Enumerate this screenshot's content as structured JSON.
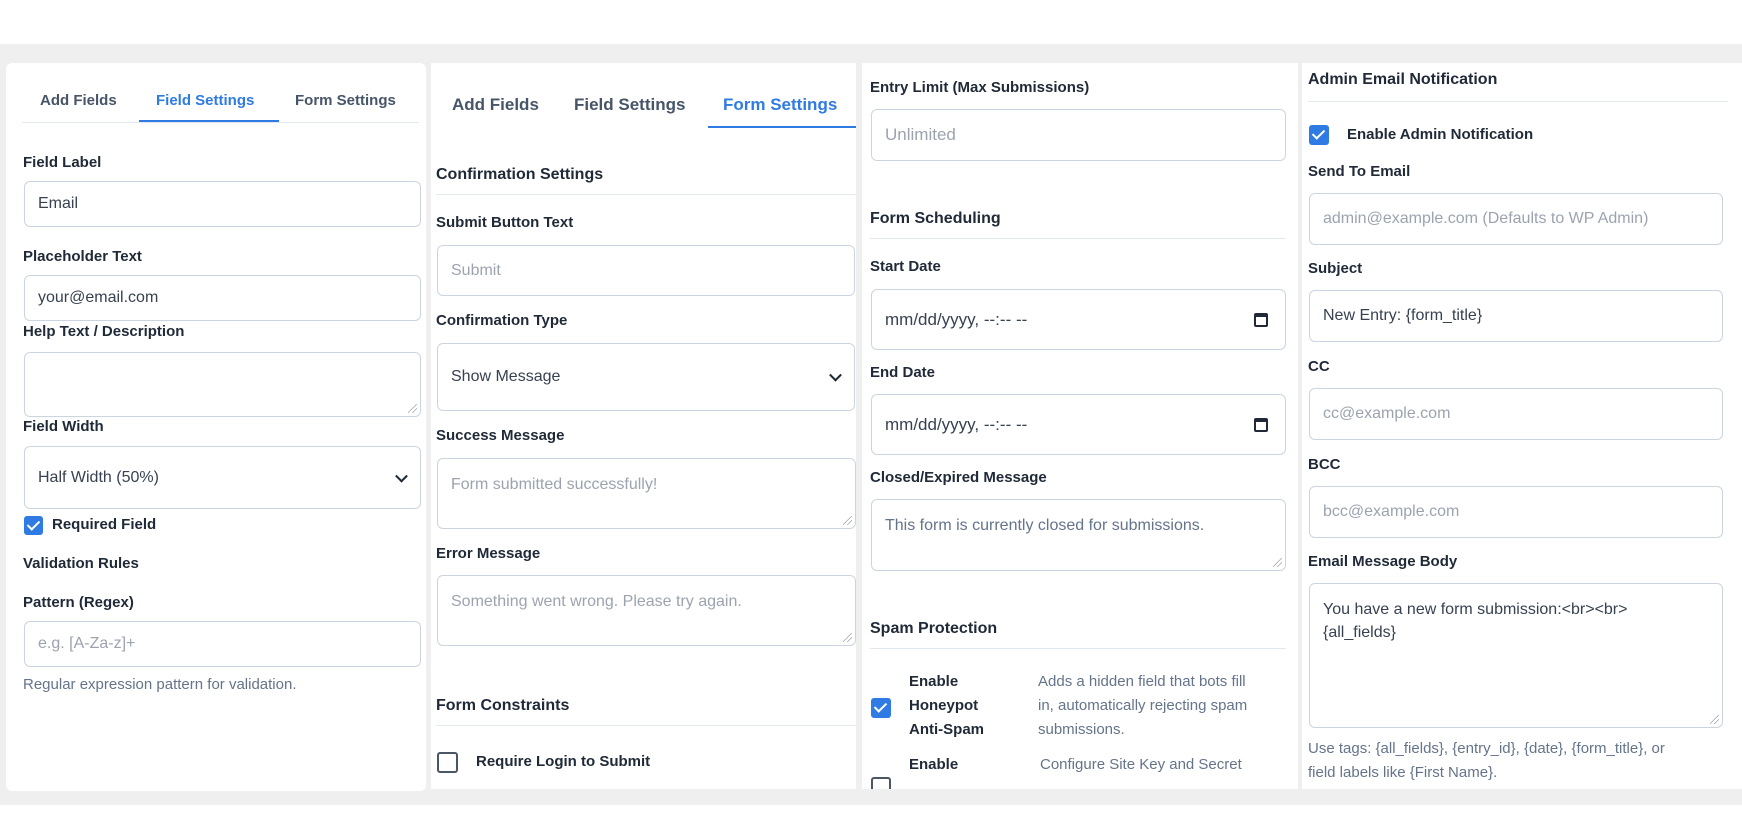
{
  "panel1": {
    "tabs": [
      "Add Fields",
      "Field Settings",
      "Form Settings"
    ],
    "field_label": "Field Label",
    "field_label_value": "Email",
    "placeholder_label": "Placeholder Text",
    "placeholder_value": "your@email.com",
    "help_label": "Help Text / Description",
    "width_label": "Field Width",
    "width_value": "Half Width (50%)",
    "required_label": "Required Field",
    "validation_title": "Validation Rules",
    "pattern_label": "Pattern (Regex)",
    "pattern_placeholder": "e.g. [A-Za-z]+",
    "pattern_help": "Regular expression pattern for validation."
  },
  "panel2": {
    "tabs": [
      "Add Fields",
      "Field Settings",
      "Form Settings"
    ],
    "confirmation_title": "Confirmation Settings",
    "submit_label": "Submit Button Text",
    "submit_placeholder": "Submit",
    "confirm_type_label": "Confirmation Type",
    "confirm_type_value": "Show Message",
    "success_label": "Success Message",
    "success_placeholder": "Form submitted successfully!",
    "error_label": "Error Message",
    "error_placeholder": "Something went wrong. Please try again.",
    "constraints_title": "Form Constraints",
    "require_login_label": "Require Login to Submit"
  },
  "panel3": {
    "entry_limit_label": "Entry Limit (Max Submissions)",
    "entry_limit_placeholder": "Unlimited",
    "scheduling_title": "Form Scheduling",
    "start_label": "Start Date",
    "start_value": "mm/dd/yyyy, --:-- --",
    "end_label": "End Date",
    "end_value": "mm/dd/yyyy, --:-- --",
    "closed_label": "Closed/Expired Message",
    "closed_placeholder": "This form is currently closed for submissions.",
    "spam_title": "Spam Protection",
    "honeypot_label": [
      "Enable",
      "Honeypot",
      "Anti-Spam"
    ],
    "honeypot_desc": [
      "Adds a hidden field that bots fill",
      "in, automatically rejecting spam",
      "submissions."
    ],
    "recaptcha_label": "Enable",
    "recaptcha_desc": "Configure Site Key and Secret"
  },
  "panel4": {
    "title": "Admin Email Notification",
    "enable_label": "Enable Admin Notification",
    "send_to_label": "Send To Email",
    "send_to_placeholder": "admin@example.com (Defaults to WP Admin)",
    "subject_label": "Subject",
    "subject_value": "New Entry: {form_title}",
    "cc_label": "CC",
    "cc_placeholder": "cc@example.com",
    "bcc_label": "BCC",
    "bcc_placeholder": "bcc@example.com",
    "body_label": "Email Message Body",
    "body_lines": [
      "You have a new form submission:<br><br>",
      "{all_fields}"
    ],
    "tags_help": [
      "Use tags: {all_fields}, {entry_id}, {date}, {form_title}, or",
      "field labels like {First Name}."
    ]
  },
  "colors": {
    "accent": "#2f7be3",
    "background": "#efefef"
  },
  "icons": [
    "chevron-down-icon",
    "calendar-icon",
    "checkbox-checked-icon",
    "checkbox-unchecked-icon",
    "resize-grip-icon"
  ]
}
